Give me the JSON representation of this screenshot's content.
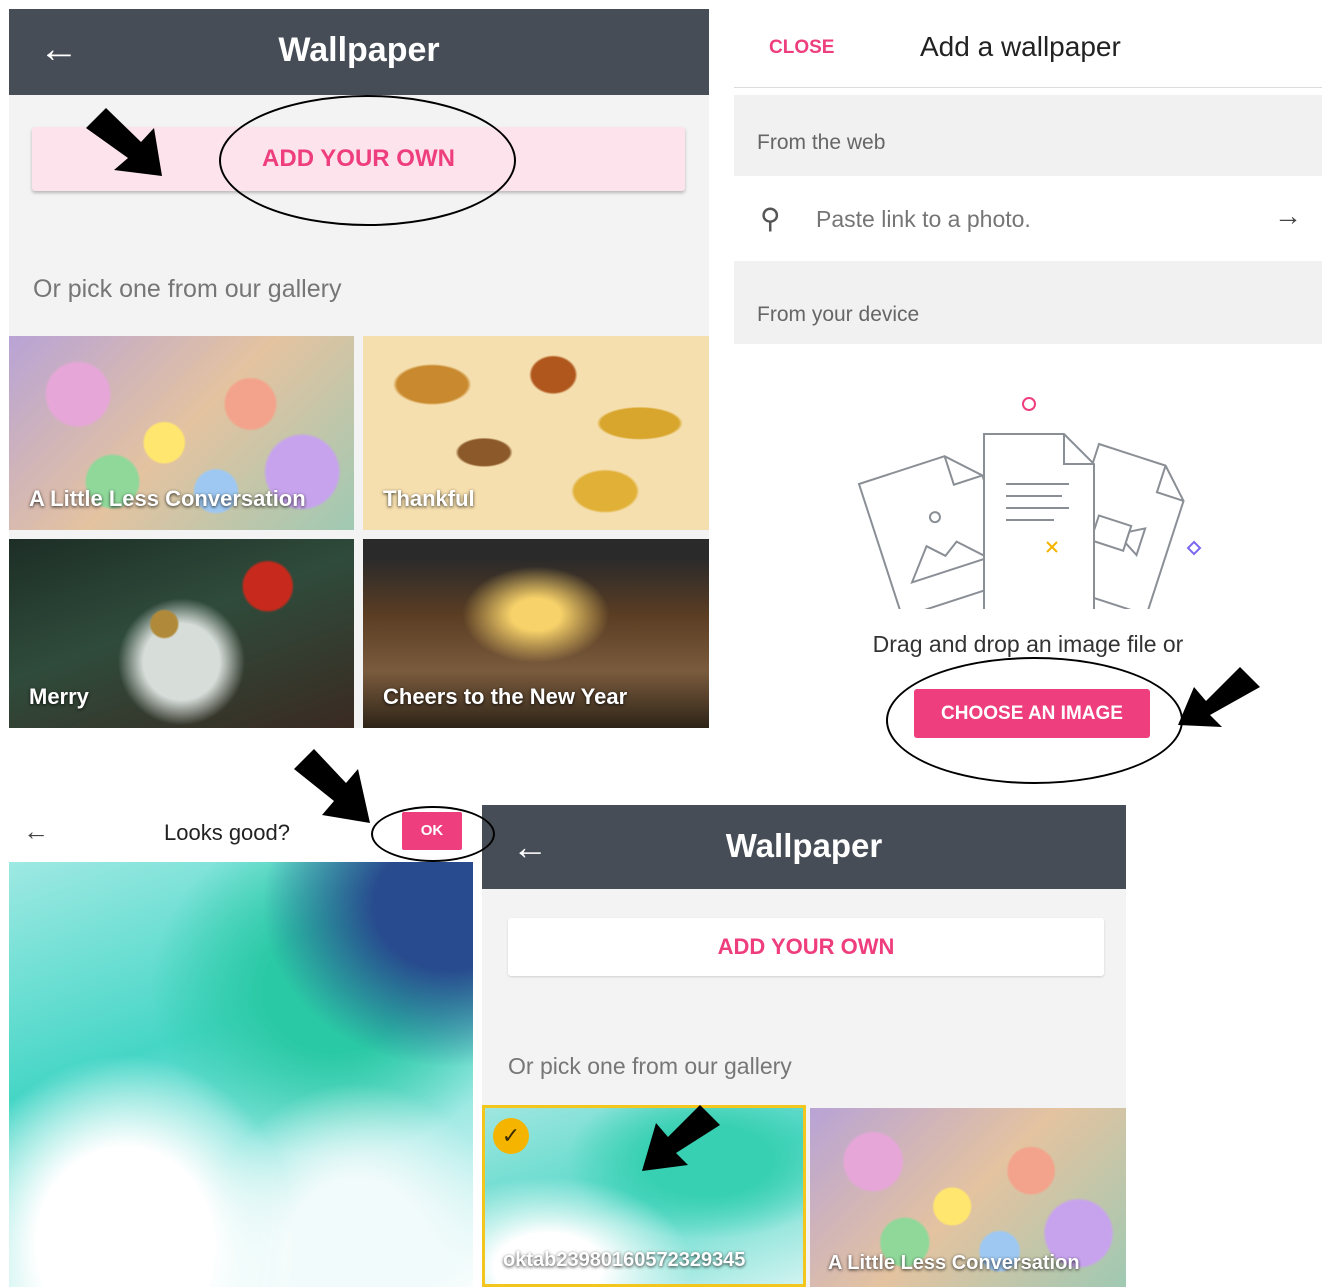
{
  "panel1": {
    "app_title": "Wallpaper",
    "add_button": "ADD YOUR OWN",
    "gallery_label": "Or pick one from our gallery",
    "tiles": [
      "A Little Less Conversation",
      "Thankful",
      "Merry",
      "Cheers to the New Year"
    ]
  },
  "panel2": {
    "close_label": "CLOSE",
    "title": "Add a wallpaper",
    "from_web_label": "From the web",
    "search_placeholder": "Paste link to a photo.",
    "from_device_label": "From your device",
    "drag_text": "Drag and drop an image file or",
    "choose_button": "CHOOSE AN IMAGE"
  },
  "panel3": {
    "title": "Looks good?",
    "ok_label": "OK"
  },
  "panel4": {
    "app_title": "Wallpaper",
    "add_button": "ADD YOUR OWN",
    "gallery_label": "Or pick one from our gallery",
    "tiles": [
      "oktab23980160572329345",
      "A Little Less Conversation"
    ]
  },
  "colors": {
    "accent": "#ee3e7d",
    "appbar": "#474d56",
    "selected_border": "#f2c61c"
  }
}
